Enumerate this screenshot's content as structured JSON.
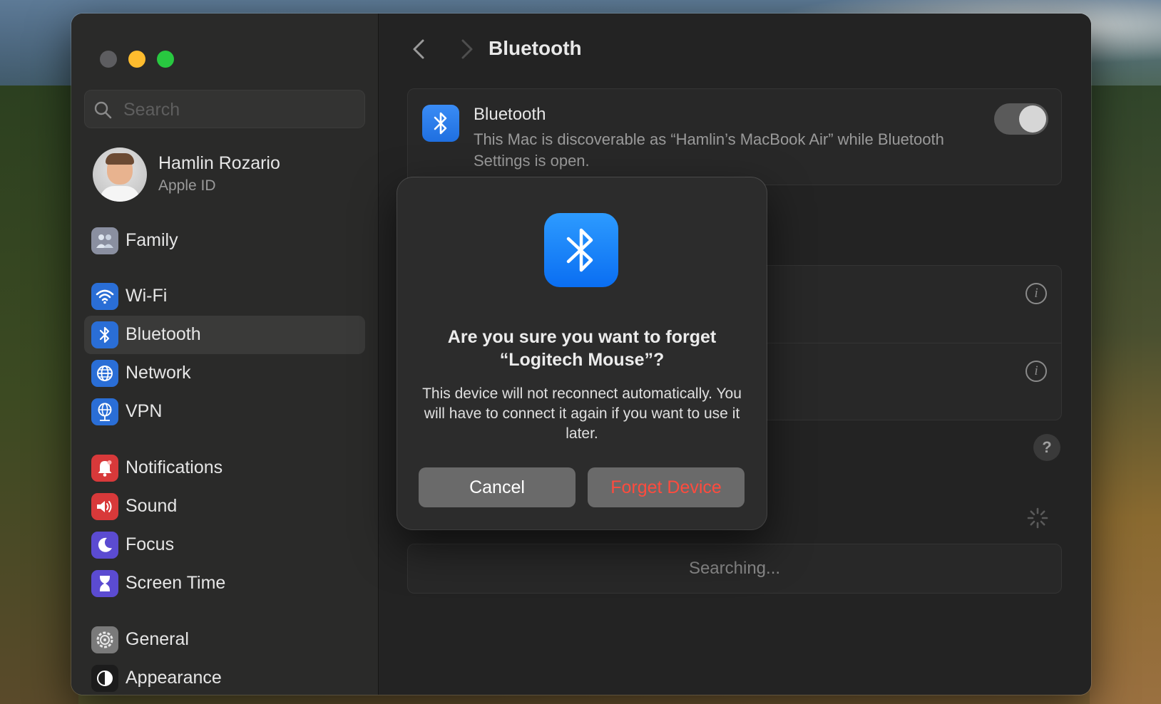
{
  "window": {
    "traffic_lights": {
      "close": "#5d5d60",
      "minimize": "#febc2e",
      "maximize": "#28c840"
    }
  },
  "sidebar": {
    "search": {
      "placeholder": "Search",
      "value": "",
      "icon": "search-icon"
    },
    "profile": {
      "name": "Hamlin Rozario",
      "subtitle": "Apple ID"
    },
    "items": [
      {
        "label": "Family",
        "icon": "family-icon",
        "color": "#8a8fa0"
      },
      {
        "label": "Wi-Fi",
        "icon": "wifi-icon",
        "color": "#2a6ed6"
      },
      {
        "label": "Bluetooth",
        "icon": "bluetooth-icon",
        "color": "#2a6ed6",
        "selected": true
      },
      {
        "label": "Network",
        "icon": "globe-icon",
        "color": "#2a6ed6"
      },
      {
        "label": "VPN",
        "icon": "vpn-icon",
        "color": "#2a6ed6"
      },
      {
        "label": "Notifications",
        "icon": "bell-icon",
        "color": "#d8393a"
      },
      {
        "label": "Sound",
        "icon": "speaker-icon",
        "color": "#d8393a"
      },
      {
        "label": "Focus",
        "icon": "moon-icon",
        "color": "#5b4bd1"
      },
      {
        "label": "Screen Time",
        "icon": "hourglass-icon",
        "color": "#5b4bd1"
      },
      {
        "label": "General",
        "icon": "gear-icon",
        "color": "#7a7a7a"
      },
      {
        "label": "Appearance",
        "icon": "appearance-icon",
        "color": "#1c1c1c"
      }
    ]
  },
  "main": {
    "title": "Bluetooth",
    "bluetooth_card": {
      "title": "Bluetooth",
      "description": "This Mac is discoverable as “Hamlin’s MacBook Air” while Bluetooth Settings is open.",
      "toggle_on": true
    },
    "help_label": "?",
    "info_label": "i",
    "searching_label": "Searching..."
  },
  "dialog": {
    "title_line1": "Are you sure you want to forget",
    "title_line2": "“Logitech Mouse”?",
    "message": "This device will not reconnect automatically. You will have to connect it again if you want to use it later.",
    "cancel_label": "Cancel",
    "forget_label": "Forget Device",
    "accent": "#0a6ef2",
    "destructive_color": "#ff4b3e"
  }
}
